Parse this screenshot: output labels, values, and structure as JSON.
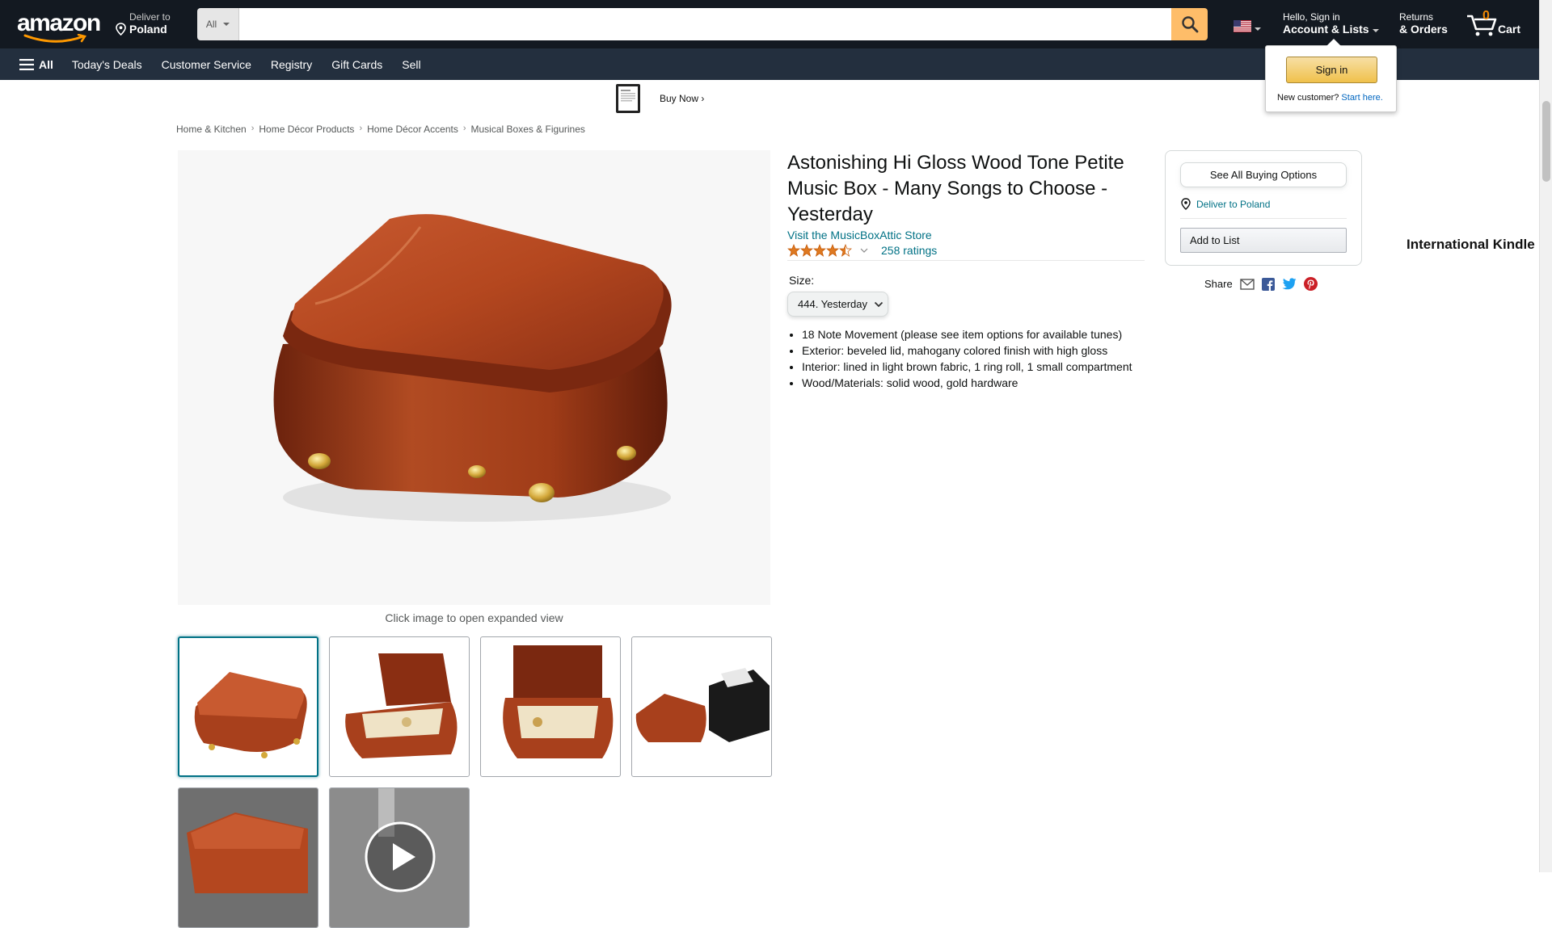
{
  "header": {
    "logo_text": "amazon",
    "deliver_small": "Deliver to",
    "deliver_big": "Poland",
    "search_category": "All",
    "search_value": "",
    "account_small": "Hello, Sign in",
    "account_big": "Account & Lists",
    "returns_small": "Returns",
    "returns_big": "& Orders",
    "cart_count": "0",
    "cart_label": "Cart"
  },
  "subnav": {
    "all_label": "All",
    "items": [
      "Today's Deals",
      "Customer Service",
      "Registry",
      "Gift Cards",
      "Sell"
    ]
  },
  "flyout": {
    "signin_label": "Sign in",
    "new_customer": "New customer?",
    "start_here": "Start here."
  },
  "banner": {
    "title": "International Kindle Paperwhite",
    "cta": "Buy Now ›"
  },
  "breadcrumb": [
    "Home & Kitchen",
    "Home Décor Products",
    "Home Décor Accents",
    "Musical Boxes & Figurines"
  ],
  "gallery": {
    "expand_note": "Click image to open expanded view"
  },
  "product": {
    "title": "Astonishing Hi Gloss Wood Tone Petite Music Box - Many Songs to Choose - Yesterday",
    "store_link": "Visit the MusicBoxAttic Store",
    "rating_stars": 4.5,
    "ratings_count": "258 ratings",
    "size_label": "Size:",
    "size_value": "444. Yesterday",
    "bullets": [
      "18 Note Movement (please see item options for available tunes)",
      "Exterior: beveled lid, mahogany colored finish with high gloss",
      "Interior: lined in light brown fabric, 1 ring roll, 1 small compartment",
      "Wood/Materials: solid wood, gold hardware"
    ]
  },
  "buybox": {
    "see_options": "See All Buying Options",
    "deliver_to": "Deliver to Poland",
    "add_to_list": "Add to List",
    "share_label": "Share"
  },
  "colors": {
    "nav_dark": "#131921",
    "nav_sub": "#232f3e",
    "search_button": "#febd69",
    "link": "#007185",
    "star": "#de7921",
    "wood": "#a8401c"
  }
}
